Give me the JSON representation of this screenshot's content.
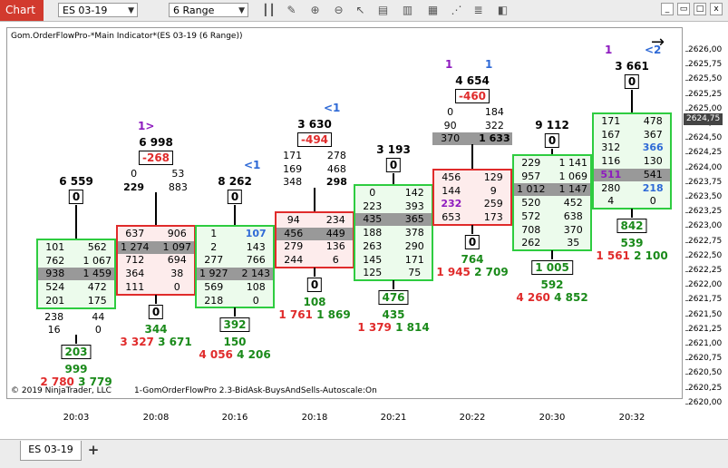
{
  "toolbar": {
    "chart_label": "Chart",
    "instrument": "ES 03-19",
    "interval": "6 Range",
    "icons": [
      "bars-icon",
      "pencil-icon",
      "zoom-in-icon",
      "zoom-out-icon",
      "pointer-icon",
      "properties-icon",
      "indicators-icon",
      "strategies-icon",
      "chart-trader-icon",
      "alerts-icon",
      "window-link-icon"
    ],
    "window": {
      "minimize": "_",
      "restore": "▭",
      "maximize": "□",
      "close": "x"
    }
  },
  "chart": {
    "indicator_label": "Gom.OrderFlowPro-*Main Indicator*(ES 03-19 (6 Range))",
    "copyright": "© 2019 NinjaTrader, LLC",
    "indicator_footer": "1-GomOrderFlowPro 2.3-BidAsk-BuysAndSells-Autoscale:On",
    "last_price": "2624,75",
    "price_ticks": [
      "2626,00",
      "2625,75",
      "2625,50",
      "2625,25",
      "2625,00",
      "2624,75",
      "2624,50",
      "2624,25",
      "2624,00",
      "2623,75",
      "2623,50",
      "2623,25",
      "2623,00",
      "2622,75",
      "2622,50",
      "2622,25",
      "2622,00",
      "2621,75",
      "2621,50",
      "2621,25",
      "2621,00",
      "2620,75",
      "2620,50",
      "2620,25",
      "2620,00"
    ],
    "time_ticks": [
      "20:03",
      "20:08",
      "20:16",
      "20:18",
      "20:21",
      "20:22",
      "20:30",
      "20:32"
    ]
  },
  "bars": [
    {
      "above": {
        "vol": "6 559",
        "delta": "0"
      },
      "rows": [
        [
          "101",
          "562"
        ],
        [
          "762",
          "1 067"
        ],
        [
          "938",
          "1 459"
        ],
        [
          "524",
          "472"
        ],
        [
          "201",
          "175"
        ]
      ],
      "outside_below": [
        [
          "238",
          "44"
        ],
        [
          "16",
          "0"
        ]
      ],
      "below": {
        "delta": "203",
        "cum": "999",
        "bs": [
          "2 780",
          "3 779"
        ]
      }
    },
    {
      "marker": "1>",
      "above": {
        "vol": "6 998",
        "delta": "-268",
        "rows": [
          [
            "0",
            "53"
          ],
          [
            "229",
            "883"
          ]
        ]
      },
      "rows": [
        [
          "637",
          "906"
        ],
        [
          "1 274",
          "1 097"
        ],
        [
          "712",
          "694"
        ],
        [
          "364",
          "38"
        ],
        [
          "111",
          "0"
        ]
      ],
      "below": {
        "delta": "0",
        "cum": "344",
        "bs": [
          "3 327",
          "3 671"
        ]
      }
    },
    {
      "marker": "<1",
      "above": {
        "vol": "8 262",
        "delta": "0"
      },
      "rows": [
        [
          "1",
          "107"
        ],
        [
          "2",
          "143"
        ],
        [
          "277",
          "766"
        ],
        [
          "1 927",
          "2 143"
        ],
        [
          "569",
          "108"
        ],
        [
          "218",
          "0"
        ]
      ],
      "below": {
        "delta": "392",
        "cum": "150",
        "bs": [
          "4 056",
          "4 206"
        ]
      }
    },
    {
      "marker": "<1",
      "above": {
        "vol": "3 630",
        "delta": "-494",
        "rows": [
          [
            "171",
            "278"
          ],
          [
            "169",
            "468"
          ],
          [
            "348",
            "298"
          ]
        ]
      },
      "rows": [
        [
          "94",
          "234"
        ],
        [
          "456",
          "449"
        ],
        [
          "279",
          "136"
        ],
        [
          "244",
          "6"
        ]
      ],
      "below": {
        "delta": "0",
        "cum": "108",
        "bs": [
          "1 761",
          "1 869"
        ]
      }
    },
    {
      "above": {
        "vol": "3 193",
        "delta": "0"
      },
      "rows": [
        [
          "0",
          "142"
        ],
        [
          "223",
          "393"
        ],
        [
          "435",
          "365"
        ],
        [
          "188",
          "378"
        ],
        [
          "263",
          "290"
        ],
        [
          "145",
          "171"
        ],
        [
          "125",
          "75"
        ]
      ],
      "below": {
        "delta": "476",
        "cum": "435",
        "bs": [
          "1 379",
          "1 814"
        ]
      }
    },
    {
      "marker": "1",
      "marker2": "1",
      "above": {
        "vol": "4 654",
        "delta": "-460",
        "rows": [
          [
            "0",
            "184"
          ],
          [
            "90",
            "322"
          ],
          [
            "370",
            "1 633"
          ]
        ]
      },
      "rows": [
        [
          "456",
          "129"
        ],
        [
          "144",
          "9"
        ],
        [
          "232",
          "259"
        ],
        [
          "653",
          "173"
        ]
      ],
      "below": {
        "delta": "0",
        "cum": "764",
        "bs": [
          "1 945",
          "2 709"
        ]
      }
    },
    {
      "above": {
        "vol": "9 112",
        "delta": "0"
      },
      "rows": [
        [
          "229",
          "1 141"
        ],
        [
          "957",
          "1 069"
        ],
        [
          "1 012",
          "1 147"
        ],
        [
          "520",
          "452"
        ],
        [
          "572",
          "638"
        ],
        [
          "708",
          "370"
        ],
        [
          "262",
          "35"
        ]
      ],
      "below": {
        "delta": "1 005",
        "cum": "592",
        "bs": [
          "4 260",
          "4 852"
        ]
      }
    },
    {
      "marker": "1",
      "marker2": "<2",
      "above": {
        "vol": "3 661",
        "delta": "0"
      },
      "rows": [
        [
          "171",
          "478"
        ],
        [
          "167",
          "367"
        ],
        [
          "312",
          "366"
        ],
        [
          "116",
          "130"
        ],
        [
          "511",
          "541"
        ],
        [
          "280",
          "218"
        ],
        [
          "4",
          "0"
        ]
      ],
      "below": {
        "delta": "842",
        "cum": "539",
        "bs": [
          "1 561",
          "2 100"
        ]
      }
    }
  ],
  "bottom": {
    "tab_label": "ES 03-19",
    "add_label": "+"
  },
  "colors": {
    "up": "#2ecc40",
    "down": "#e02b2b",
    "poc": "#999999",
    "tab_red": "#d23a2e"
  }
}
